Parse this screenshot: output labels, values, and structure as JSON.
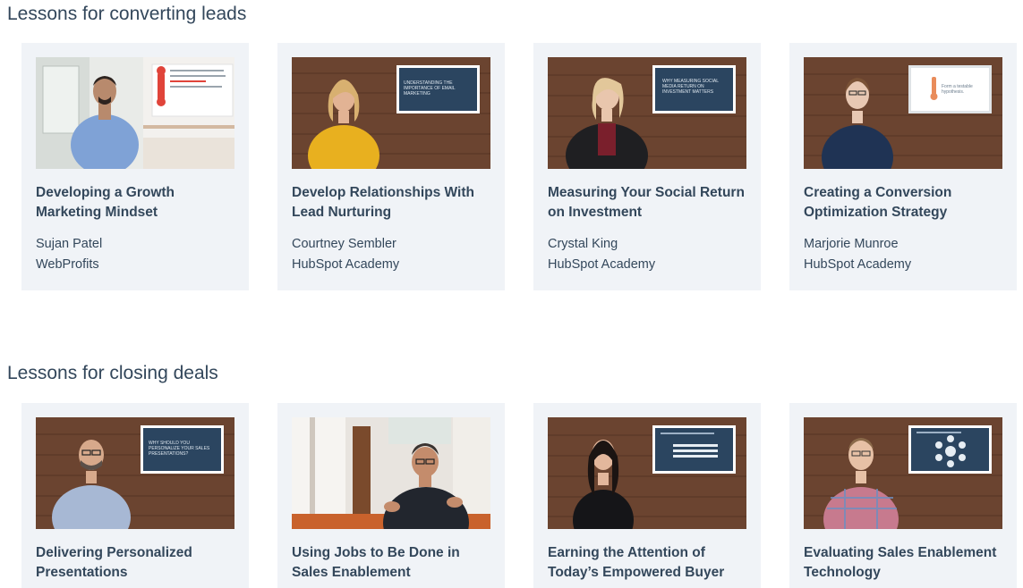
{
  "sections": [
    {
      "title": "Lessons for converting leads",
      "cards": [
        {
          "title": "Developing a Growth Marketing Mindset",
          "author": "Sujan Patel",
          "org": "WebProfits",
          "thumbnail_icon": "presenter-office-video-thumbnail"
        },
        {
          "title": "Develop Relationships With Lead Nurturing",
          "author": "Courtney Sembler",
          "org": "HubSpot Academy",
          "slide_text": "UNDERSTANDING THE IMPORTANCE OF EMAIL MARKETING",
          "thumbnail_icon": "presenter-wood-wall-video-thumbnail"
        },
        {
          "title": "Measuring Your Social Return on Investment",
          "author": "Crystal King",
          "org": "HubSpot Academy",
          "slide_text": "WHY MEASURING SOCIAL MEDIA RETURN ON INVESTMENT MATTERS",
          "thumbnail_icon": "presenter-wood-wall-video-thumbnail"
        },
        {
          "title": "Creating a Conversion Optimization Strategy",
          "author": "Marjorie Munroe",
          "org": "HubSpot Academy",
          "slide_text": "Form a testable hypothesis.",
          "thumbnail_icon": "presenter-wood-wall-video-thumbnail"
        }
      ]
    },
    {
      "title": "Lessons for closing deals",
      "cards": [
        {
          "title": "Delivering Personalized Presentations",
          "slide_text": "WHY SHOULD YOU PERSONALIZE YOUR SALES PRESENTATIONS?",
          "thumbnail_icon": "presenter-wood-wall-video-thumbnail"
        },
        {
          "title": "Using Jobs to Be Done in Sales Enablement",
          "thumbnail_icon": "seated-speaker-office-video-thumbnail"
        },
        {
          "title": "Earning the Attention of Today’s Empowered Buyer",
          "thumbnail_icon": "presenter-wood-wall-video-thumbnail"
        },
        {
          "title": "Evaluating Sales Enablement Technology",
          "thumbnail_icon": "presenter-wood-wall-video-thumbnail"
        }
      ]
    }
  ],
  "colors": {
    "text": "#33475b",
    "card_bg": "#f0f3f7",
    "slide_bg": "#2b4560",
    "wood": "#6b4430"
  }
}
